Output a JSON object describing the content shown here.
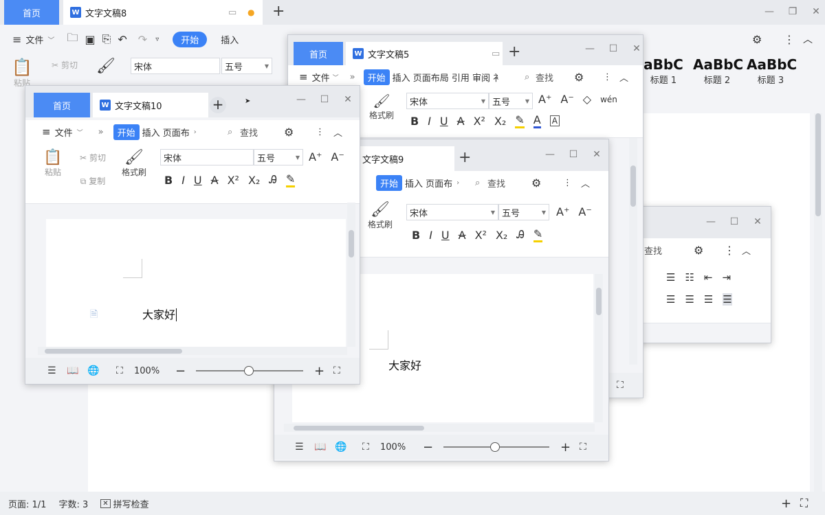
{
  "win8": {
    "tab_home": "首页",
    "tab_doc": "文字文稿8",
    "menu_file": "文件",
    "start": "开始",
    "insert": "插入",
    "paste": "粘贴",
    "cut": "剪切",
    "font": "宋体",
    "size": "五号",
    "styles": [
      {
        "sample": "aBbC",
        "label": "标题 1"
      },
      {
        "sample": "AaBbC",
        "label": "标题 2"
      },
      {
        "sample": "AaBbC",
        "label": "标题 3"
      }
    ],
    "status_page": "页面: 1/1",
    "status_words": "字数: 3",
    "status_spell": "拼写检查"
  },
  "win5": {
    "tab_home": "首页",
    "tab_doc": "文字文稿5",
    "menu_file": "文件",
    "start": "开始",
    "menu_rest": "插入 页面布局 引用 审阅 衤",
    "search": "查找",
    "font": "宋体",
    "size": "五号",
    "format_painter": "格式刷"
  },
  "win10": {
    "tab_home": "首页",
    "tab_doc": "文字文稿10",
    "menu_file": "文件",
    "start": "开始",
    "menu_rest": "插入 页面布",
    "search": "查找",
    "paste": "粘贴",
    "cut": "剪切",
    "copy": "复制",
    "format_painter": "格式刷",
    "font": "宋体",
    "size": "五号",
    "doc_text": "大家好",
    "zoom": "100%"
  },
  "win9": {
    "tab_doc": "文字文稿9",
    "start": "开始",
    "menu_rest": "插入 页面布",
    "search": "查找",
    "format_painter": "格式刷",
    "font": "宋体",
    "size": "五号",
    "doc_text": "大家好",
    "zoom": "100%"
  },
  "winback": {
    "search": "查找"
  },
  "colors": {
    "accent": "#4b8bf4",
    "start_pill": "#3b82f6"
  }
}
